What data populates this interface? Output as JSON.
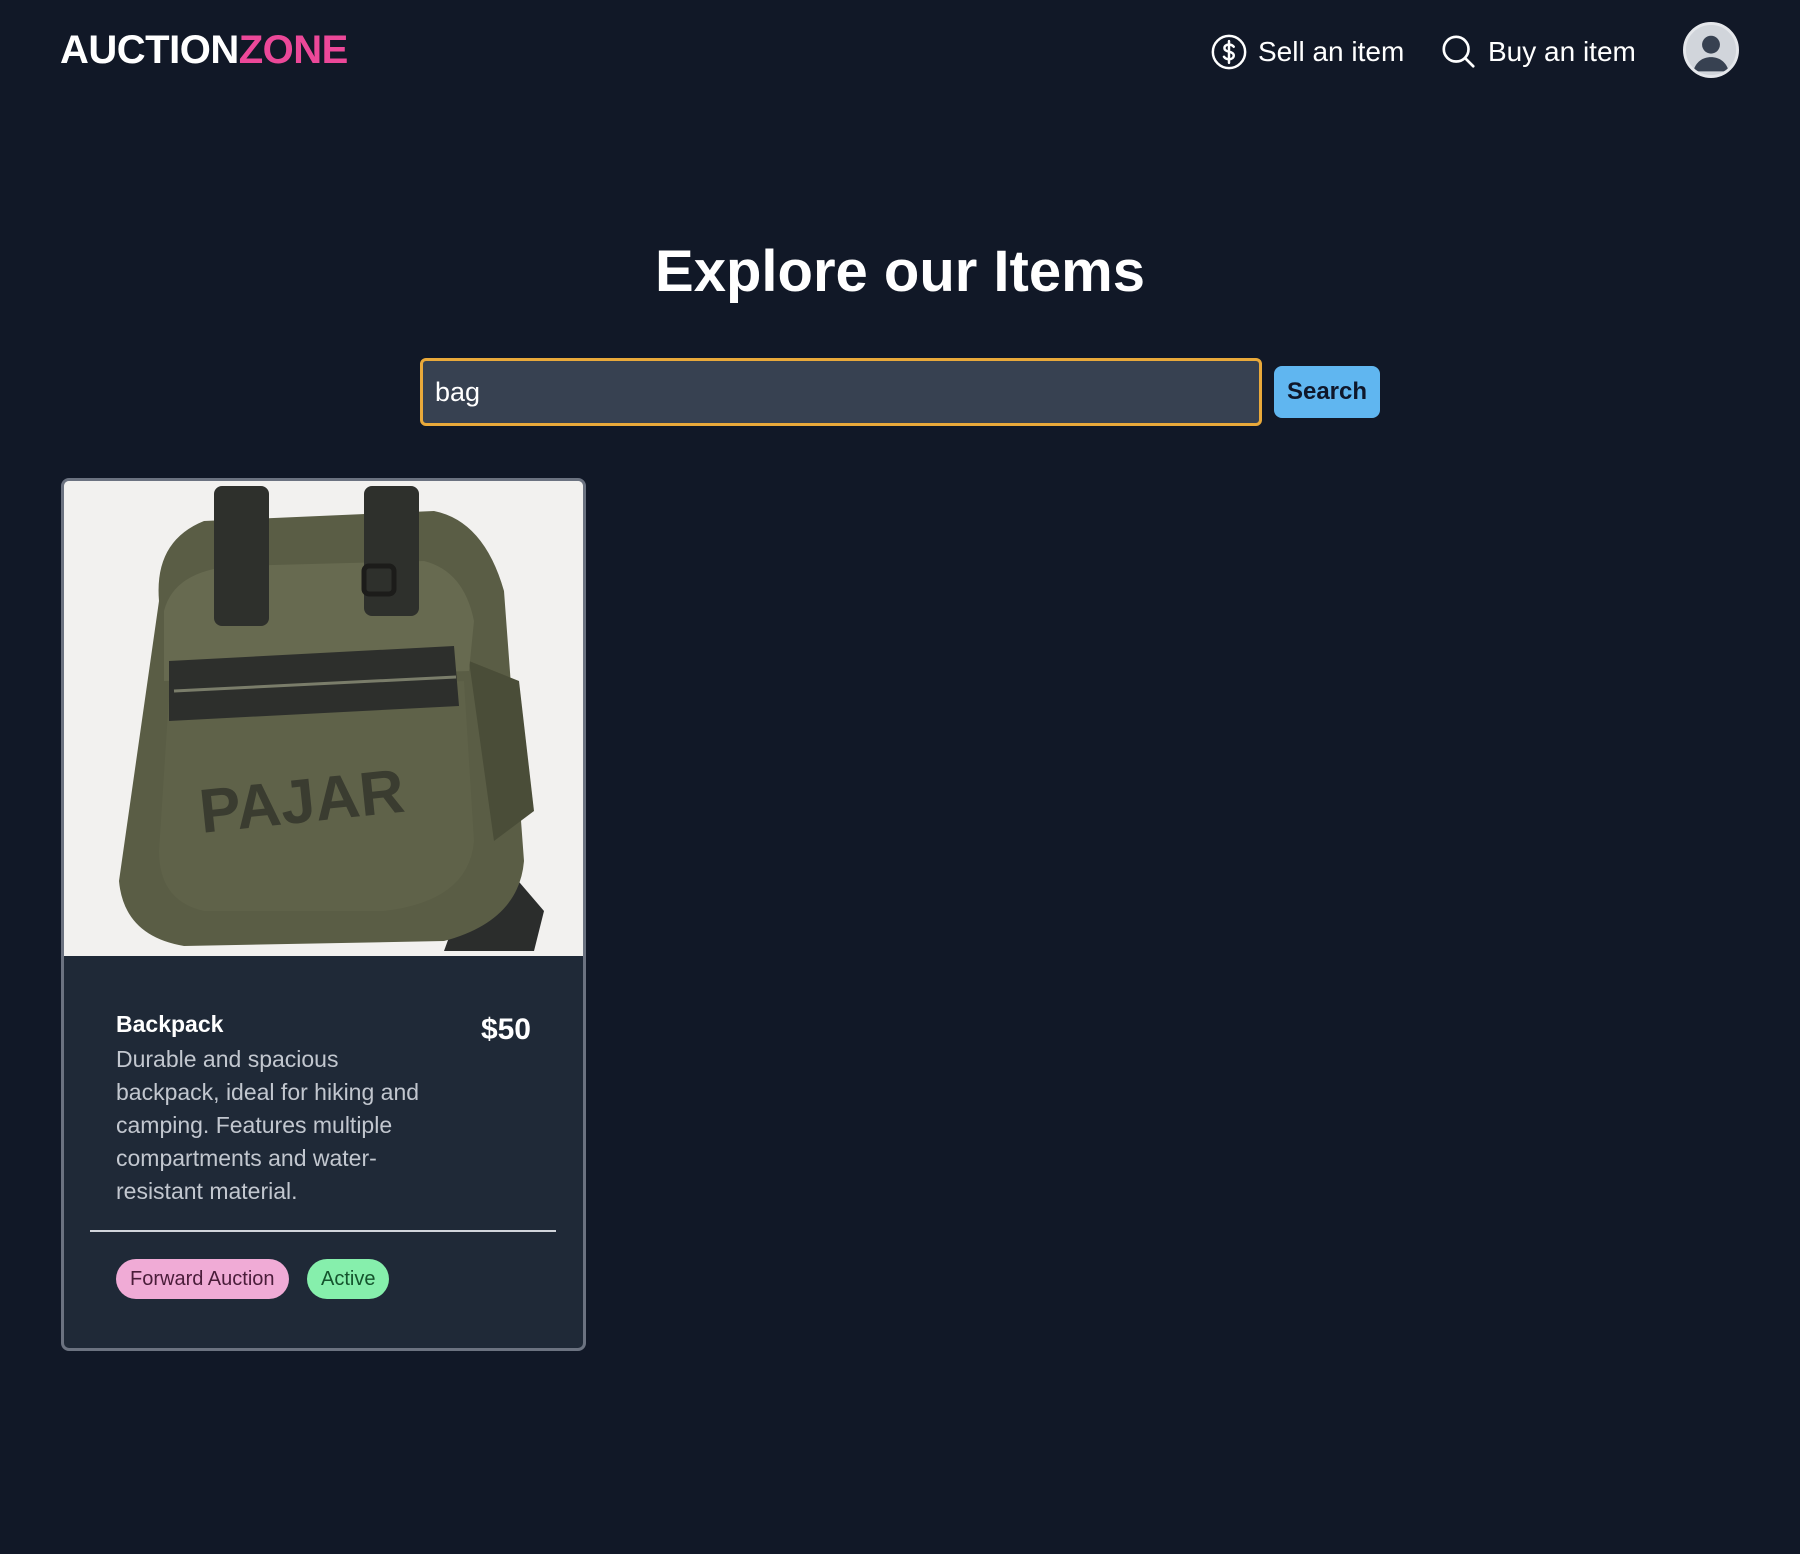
{
  "header": {
    "logo_part1": "AUCTION",
    "logo_part2": "ZONE",
    "nav": [
      {
        "label": "Sell an item",
        "icon": "dollar-circle-icon"
      },
      {
        "label": "Buy an item",
        "icon": "search-icon"
      }
    ],
    "avatar_icon": "user-avatar-icon"
  },
  "main": {
    "title": "Explore our Items",
    "search": {
      "value": "bag",
      "button_label": "Search"
    }
  },
  "items": [
    {
      "title": "Backpack",
      "price": "$50",
      "description": "Durable and spacious backpack, ideal for hiking and camping. Features multiple compartments and water-resistant material.",
      "image_label": "PAJAR",
      "type_badge": "Forward Auction",
      "status_badge": "Active"
    }
  ],
  "colors": {
    "background": "#111827",
    "logo_accent": "#ec4899",
    "search_border": "#e9a93a",
    "search_button": "#60b6f0",
    "card_bg": "#1f2937",
    "badge_type": "#f0abd6",
    "badge_status": "#86efac"
  }
}
